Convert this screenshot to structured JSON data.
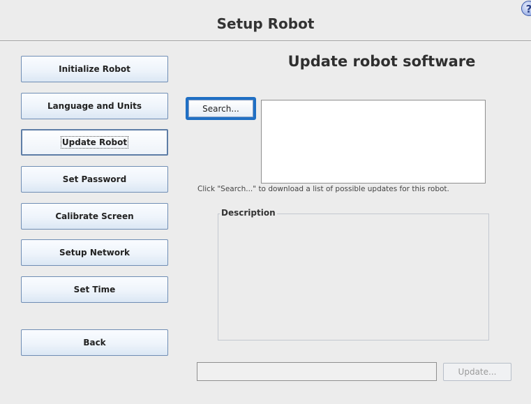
{
  "header": {
    "title": "Setup Robot",
    "help_icon": "help-icon",
    "help_glyph": "?"
  },
  "sidebar": {
    "items": [
      {
        "label": "Initialize Robot",
        "active": false
      },
      {
        "label": "Language and Units",
        "active": false
      },
      {
        "label": "Update Robot",
        "active": true
      },
      {
        "label": "Set Password",
        "active": false
      },
      {
        "label": "Calibrate Screen",
        "active": false
      },
      {
        "label": "Setup Network",
        "active": false
      },
      {
        "label": "Set Time",
        "active": false
      }
    ],
    "back_label": "Back"
  },
  "main": {
    "title": "Update robot software",
    "search_label": "Search...",
    "hint": "Click \"Search...\" to download a list of possible updates for this robot.",
    "description_label": "Description",
    "update_label": "Update..."
  },
  "colors": {
    "focus": "#1f6fc4",
    "button_border": "#6f8db4"
  }
}
